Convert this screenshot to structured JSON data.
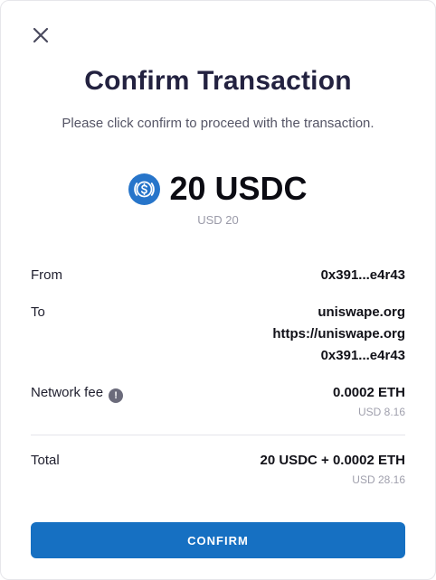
{
  "header": {
    "close_icon": "close-icon",
    "title": "Confirm Transaction",
    "subtitle": "Please click confirm to proceed with the transaction."
  },
  "amount": {
    "token_icon": "usdc-icon",
    "value": "20 USDC",
    "usd": "USD 20"
  },
  "details": {
    "from_label": "From",
    "from_value": "0x391...e4r43",
    "to_label": "To",
    "to_values": [
      "uniswape.org",
      "https://uniswape.org",
      "0x391...e4r43"
    ],
    "fee_label": "Network fee",
    "fee_info_icon": "info-icon",
    "fee_value": "0.0002 ETH",
    "fee_usd": "USD 8.16",
    "total_label": "Total",
    "total_value": "20 USDC + 0.0002 ETH",
    "total_usd": "USD 28.16"
  },
  "actions": {
    "confirm_label": "CONFIRM"
  },
  "colors": {
    "accent": "#1670c2",
    "usdc_blue": "#2775ca",
    "title": "#232240"
  }
}
